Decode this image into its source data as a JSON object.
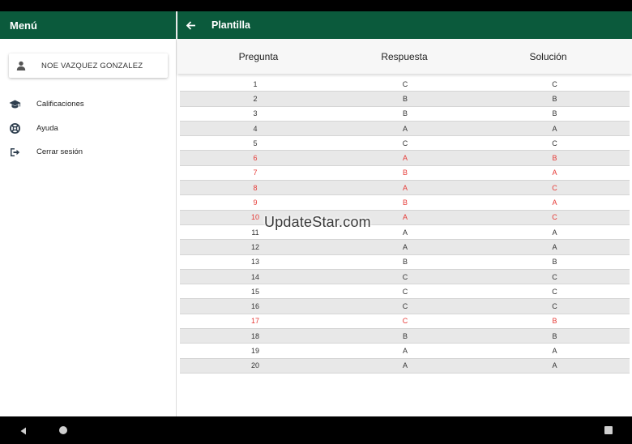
{
  "drawer": {
    "title": "Menú",
    "user_name": "NOE VAZQUEZ GONZALEZ",
    "items": [
      {
        "label": "Calificaciones",
        "icon": "graduation-cap-icon"
      },
      {
        "label": "Ayuda",
        "icon": "life-ring-icon"
      },
      {
        "label": "Cerrar sesión",
        "icon": "sign-out-icon"
      }
    ]
  },
  "app_bar": {
    "title": "Plantilla",
    "back_icon": "arrow-left-icon"
  },
  "table": {
    "headers": [
      "Pregunta",
      "Respuesta",
      "Solución"
    ],
    "rows": [
      {
        "q": "1",
        "answer": "C",
        "solution": "C"
      },
      {
        "q": "2",
        "answer": "B",
        "solution": "B"
      },
      {
        "q": "3",
        "answer": "B",
        "solution": "B"
      },
      {
        "q": "4",
        "answer": "A",
        "solution": "A"
      },
      {
        "q": "5",
        "answer": "C",
        "solution": "C"
      },
      {
        "q": "6",
        "answer": "A",
        "solution": "B"
      },
      {
        "q": "7",
        "answer": "B",
        "solution": "A"
      },
      {
        "q": "8",
        "answer": "A",
        "solution": "C"
      },
      {
        "q": "9",
        "answer": "B",
        "solution": "A"
      },
      {
        "q": "10",
        "answer": "A",
        "solution": "C"
      },
      {
        "q": "11",
        "answer": "A",
        "solution": "A"
      },
      {
        "q": "12",
        "answer": "A",
        "solution": "A"
      },
      {
        "q": "13",
        "answer": "B",
        "solution": "B"
      },
      {
        "q": "14",
        "answer": "C",
        "solution": "C"
      },
      {
        "q": "15",
        "answer": "C",
        "solution": "C"
      },
      {
        "q": "16",
        "answer": "C",
        "solution": "C"
      },
      {
        "q": "17",
        "answer": "C",
        "solution": "B"
      },
      {
        "q": "18",
        "answer": "B",
        "solution": "B"
      },
      {
        "q": "19",
        "answer": "A",
        "solution": "A"
      },
      {
        "q": "20",
        "answer": "A",
        "solution": "A"
      }
    ]
  },
  "watermark": "UpdateStar.com",
  "colors": {
    "primary": "#0b5a3c",
    "wrong": "#e53935",
    "row_alt": "#e8e8e8"
  }
}
